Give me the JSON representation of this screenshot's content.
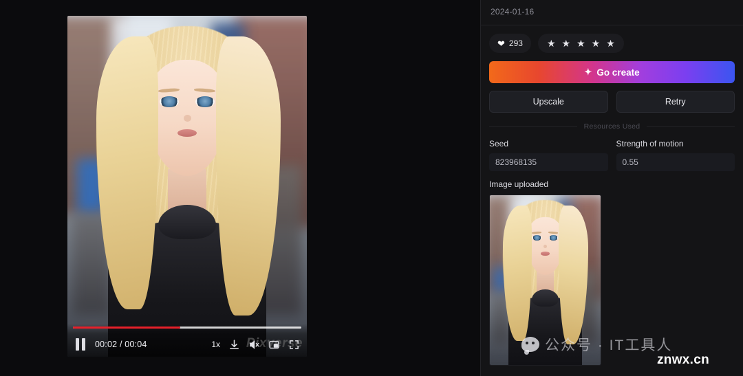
{
  "video_player": {
    "time_current": "00:02",
    "time_total": "00:04",
    "time_display": "00:02 / 00:04",
    "progress_percent": 47,
    "playback_speed": "1x",
    "state": "playing",
    "watermark": "Pixverse",
    "icons": {
      "pause": "pause-icon",
      "download": "download-icon",
      "mute": "mute-icon",
      "pip": "picture-in-picture-icon",
      "fullscreen": "fullscreen-icon"
    }
  },
  "panel": {
    "date": "2024-01-16",
    "likes": {
      "icon": "heart-icon",
      "count": "293"
    },
    "rating": {
      "stars_filled": 5,
      "star_glyph": "★"
    },
    "go_create": {
      "label": "Go create",
      "sparkle": "✦",
      "gradient_from": "#f2691a",
      "gradient_mid": "#a13ede",
      "gradient_to": "#3b55f0"
    },
    "upscale_label": "Upscale",
    "retry_label": "Retry",
    "resources_used_label": "Resources Used",
    "fields": [
      {
        "label": "Seed",
        "value": "823968135"
      },
      {
        "label": "Strength of motion",
        "value": "0.55"
      }
    ],
    "image_uploaded_label": "Image uploaded"
  },
  "watermarks": {
    "wechat": "公众号 · IT工具人",
    "site": "znwx.cn"
  }
}
